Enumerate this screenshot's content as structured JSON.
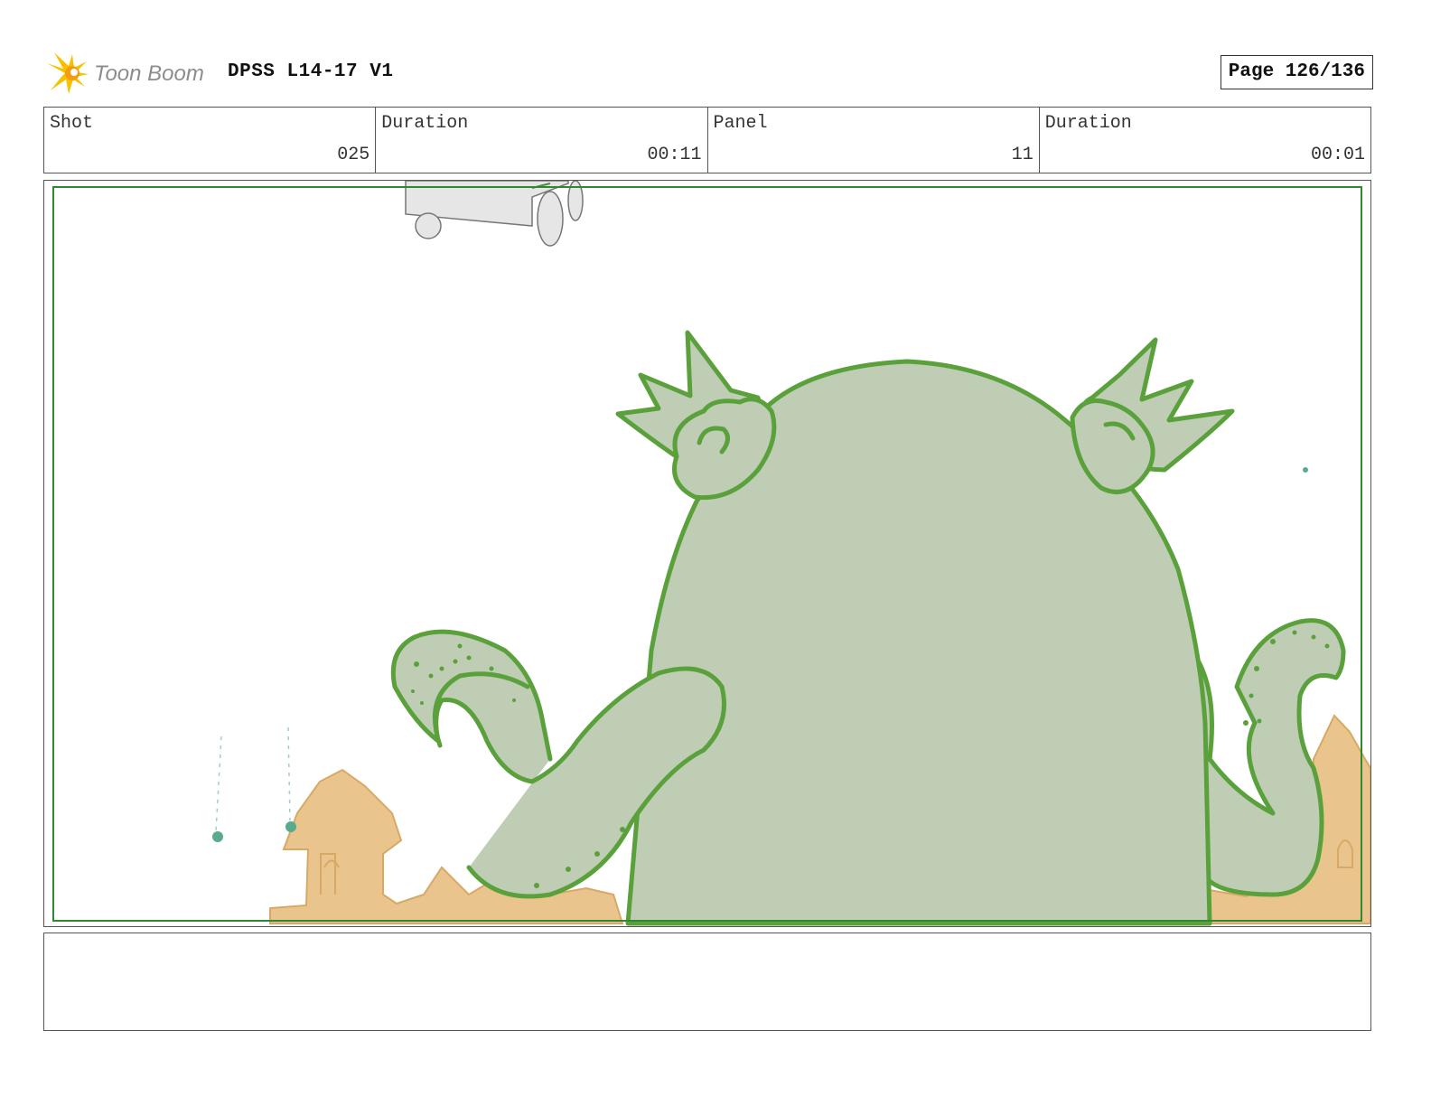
{
  "header": {
    "logo_text": "Toon Boom",
    "project_title": "DPSS L14-17 V1",
    "page_label": "Page 126/136"
  },
  "info": {
    "shot_label": "Shot",
    "shot_value": "025",
    "shot_duration_label": "Duration",
    "shot_duration_value": "00:11",
    "panel_label": "Panel",
    "panel_value": "11",
    "panel_duration_label": "Duration",
    "panel_duration_value": "00:01"
  },
  "notes": {
    "text": ""
  },
  "colors": {
    "creature_fill": "#bfcdb5",
    "creature_line": "#5aa13c",
    "sandcastle": "#e9c48c",
    "frame_green": "#2f8a2f",
    "cart_gray": "#e6e6e6"
  }
}
